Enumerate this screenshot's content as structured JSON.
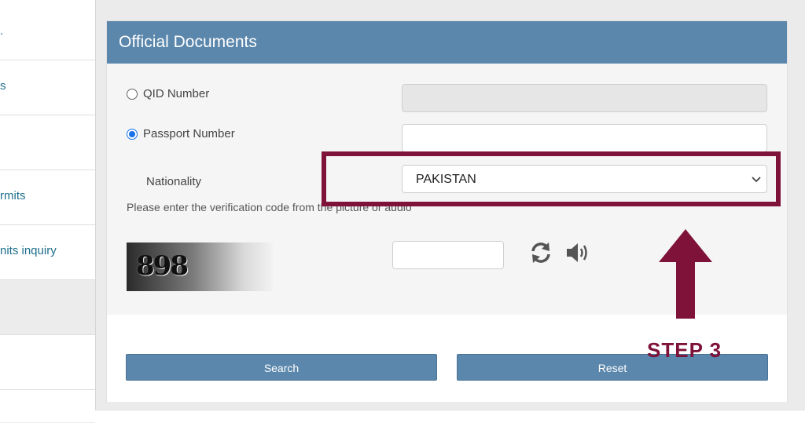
{
  "sidebar": {
    "items": [
      {
        "label": "."
      },
      {
        "label": "s"
      },
      {
        "label": ""
      },
      {
        "label": "rmits"
      },
      {
        "label": "nits inquiry"
      },
      {
        "label": ""
      },
      {
        "label": ""
      }
    ]
  },
  "panel": {
    "title": "Official Documents",
    "qid_label": "QID Number",
    "passport_label": "Passport Number",
    "passport_value": "",
    "nationality_label": "Nationality",
    "nationality_value": "PAKISTAN",
    "captcha_hint": "Please enter the verification code from the picture or audio",
    "captcha_code": "898",
    "captcha_value": "",
    "search_label": "Search",
    "reset_label": "Reset"
  },
  "annotation": {
    "step_label": "STEP 3",
    "color": "#7f1239"
  },
  "colors": {
    "header_bg": "#5b87ac",
    "accent_link": "#1f6f8b"
  },
  "icons": [
    "refresh-icon",
    "audio-icon",
    "chevron-down-icon"
  ]
}
